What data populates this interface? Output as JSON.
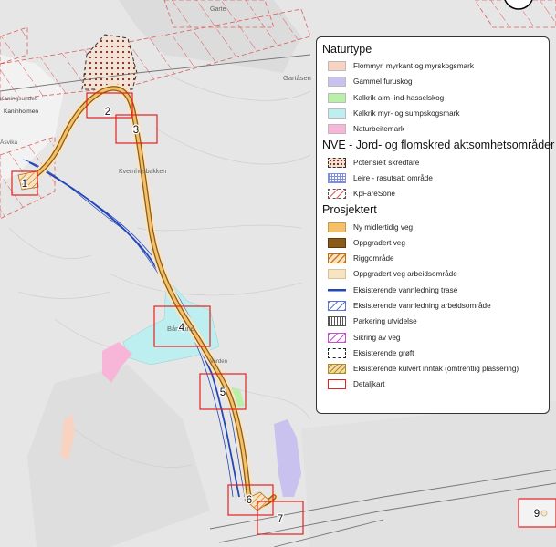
{
  "map_labels": {
    "top_label": "Garte",
    "place_gartaasen": "Gartåsen",
    "place_kaninholmen": "Kaninholmen",
    "place_kaningsundet": "Kaningsundet",
    "place_bakken": "Kvernhusbakken",
    "place_baannane": "Bånnane",
    "place_vika": "Åsvika",
    "place_mark": "Varden"
  },
  "detail_boxes": [
    "1",
    "2",
    "3",
    "4",
    "5",
    "6",
    "7",
    "9"
  ],
  "legend": {
    "sections": [
      {
        "title": "Naturtype",
        "items": [
          {
            "label": "Flommyr, myrkant og myrskogsmark",
            "swatch": "fill-peach"
          },
          {
            "label": "Gammel furuskog",
            "swatch": "fill-lavender"
          },
          {
            "label": "Kalkrik alm-lind-hasselskog",
            "swatch": "fill-lightgreen"
          },
          {
            "label": "Kalkrik myr- og sumpskogsmark",
            "swatch": "fill-lightcyan"
          },
          {
            "label": "Naturbeitemark",
            "swatch": "fill-pink"
          }
        ]
      },
      {
        "title": "NVE - Jord- og flomskred aktsomhetsområder",
        "items": [
          {
            "label": "Potensielt skredfare",
            "swatch": "dotted-hatch"
          },
          {
            "label": "Leire - rasutsatt område",
            "swatch": "blue-crosshatch"
          },
          {
            "label": "KpFareSone",
            "swatch": "red-dash-diagonal"
          }
        ]
      },
      {
        "title": "Prosjektert",
        "items": [
          {
            "label": "Ny midlertidig veg",
            "swatch": "fill-orange"
          },
          {
            "label": "Oppgradert veg",
            "swatch": "fill-brown"
          },
          {
            "label": "Riggområde",
            "swatch": "orange-hatch"
          },
          {
            "label": "Oppgradert veg arbeidsområde",
            "swatch": "fill-cream"
          },
          {
            "label": "Eksisterende vannledning trasé",
            "swatch": "blue-line"
          },
          {
            "label": "Eksisterende vannledning arbeidsområde",
            "swatch": "blue-diagonal"
          },
          {
            "label": "Parkering utvidelse",
            "swatch": "grey-vertical"
          },
          {
            "label": "Sikring av veg",
            "swatch": "magenta-diagonal"
          },
          {
            "label": "Eksisterende grøft",
            "swatch": "black-dashed"
          },
          {
            "label": "Eksisterende kulvert inntak (omtrentlig plassering)",
            "swatch": "gold-hatch"
          },
          {
            "label": "Detaljkart",
            "swatch": "red-outline"
          }
        ]
      }
    ]
  },
  "colors": {
    "peach": "#f9d3c2",
    "lavender": "#c9c2ef",
    "lightgreen": "#b9f0a8",
    "lightcyan": "#bdeef0",
    "pink": "#f7b6d8",
    "orange": "#f4c06a",
    "brown": "#8b5a16",
    "cream": "#f7e4c2",
    "water_line": "#2447b8",
    "detail_box": "#e22222"
  }
}
